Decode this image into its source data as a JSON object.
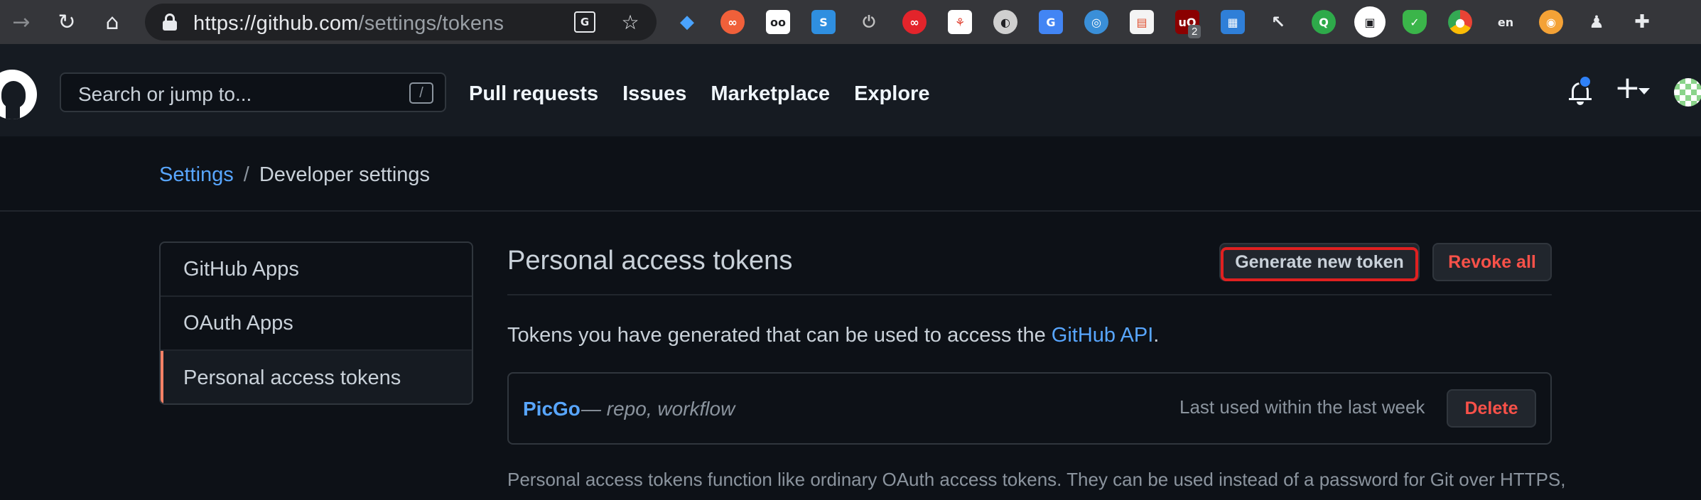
{
  "browser": {
    "url_host": "https://github.com",
    "url_path": "/settings/tokens",
    "extension_badge": "2"
  },
  "header": {
    "search_placeholder": "Search or jump to...",
    "search_shortcut": "/",
    "nav": [
      "Pull requests",
      "Issues",
      "Marketplace",
      "Explore"
    ]
  },
  "breadcrumb": {
    "settings": "Settings",
    "separator": "/",
    "current": "Developer settings"
  },
  "sidebar": {
    "items": [
      "GitHub Apps",
      "OAuth Apps",
      "Personal access tokens"
    ],
    "active_index": 2
  },
  "main": {
    "title": "Personal access tokens",
    "generate_button": "Generate new token",
    "revoke_button": "Revoke all",
    "description_prefix": "Tokens you have generated that can be used to access the ",
    "description_link": "GitHub API",
    "description_suffix": ".",
    "token": {
      "name": "PicGo",
      "scopes": "— repo, workflow",
      "last_used": "Last used within the last week",
      "delete_button": "Delete"
    },
    "footer_text": "Personal access tokens function like ordinary OAuth access tokens. They can be used instead of a password for Git over HTTPS,"
  },
  "colors": {
    "accent_link": "#58a6ff",
    "danger": "#f85149",
    "active_marker": "#f78166",
    "highlight_box": "#e02020"
  }
}
